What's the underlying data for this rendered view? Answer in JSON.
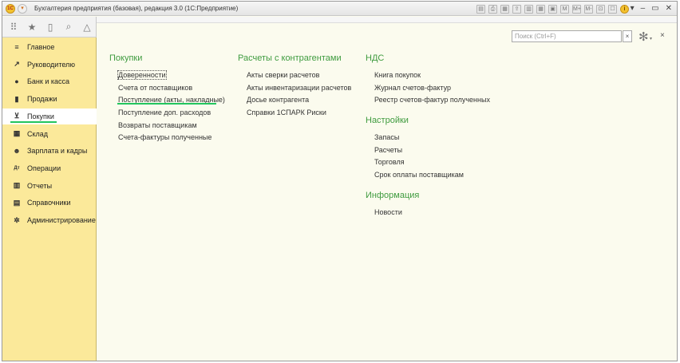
{
  "titlebar": {
    "logo": "1С",
    "title": "Бухгалтерия предприятия (базовая), редакция 3.0  (1С:Предприятие)",
    "tools": [
      "save-icon",
      "print-icon",
      "print-preview-icon",
      "upload-icon",
      "calendar-icon",
      "table-icon",
      "calculator-icon"
    ],
    "tool_glyphs": [
      "▤",
      "⎙",
      "▦",
      "⇪",
      "▥",
      "▦",
      "▣"
    ],
    "memory_labels": [
      "M",
      "M+",
      "M-"
    ],
    "zoom_glyph": "⊡",
    "history_glyph": "☐",
    "help_glyph": "i",
    "window_controls": [
      "▾",
      "–",
      "▭",
      "✕"
    ]
  },
  "toolstrip": {
    "icons": [
      {
        "name": "apps-grid-icon",
        "glyph": "⠿"
      },
      {
        "name": "favorites-star-icon",
        "glyph": "★"
      },
      {
        "name": "history-icon",
        "glyph": "▯"
      },
      {
        "name": "search-icon",
        "glyph": "⌕"
      },
      {
        "name": "notifications-bell-icon",
        "glyph": "△"
      }
    ]
  },
  "sidebar": {
    "items": [
      {
        "label": "Главное",
        "glyph": "≡",
        "name": "sidebar-item-main",
        "icon": "menu-lines-icon"
      },
      {
        "label": "Руководителю",
        "glyph": "↗",
        "name": "sidebar-item-manager",
        "icon": "trend-icon"
      },
      {
        "label": "Банк и касса",
        "glyph": "●",
        "name": "sidebar-item-bank",
        "icon": "coin-icon"
      },
      {
        "label": "Продажи",
        "glyph": "▮",
        "name": "sidebar-item-sales",
        "icon": "bag-icon"
      },
      {
        "label": "Покупки",
        "glyph": "⊻",
        "name": "sidebar-item-purchases",
        "icon": "cart-icon",
        "active": true
      },
      {
        "label": "Склад",
        "glyph": "▦",
        "name": "sidebar-item-warehouse",
        "icon": "warehouse-icon"
      },
      {
        "label": "Зарплата и кадры",
        "glyph": "☻",
        "name": "sidebar-item-salary",
        "icon": "person-icon"
      },
      {
        "label": "Операции",
        "glyph": "Дт",
        "name": "sidebar-item-operations",
        "icon": "debit-credit-icon"
      },
      {
        "label": "Отчеты",
        "glyph": "▥",
        "name": "sidebar-item-reports",
        "icon": "bar-chart-icon"
      },
      {
        "label": "Справочники",
        "glyph": "▤",
        "name": "sidebar-item-directories",
        "icon": "book-icon"
      },
      {
        "label": "Администрирование",
        "glyph": "✲",
        "name": "sidebar-item-admin",
        "icon": "gear-icon"
      }
    ]
  },
  "search": {
    "placeholder": "Поиск (Ctrl+F)",
    "clear": "×"
  },
  "main": {
    "settings_glyph": "✻",
    "settings_caret": "▾",
    "close_glyph": "×",
    "columns": [
      {
        "sections": [
          {
            "title": "Покупки",
            "links": [
              "Доверенности",
              "Счета от поставщиков",
              "Поступление (акты, накладные)",
              "Поступление доп. расходов",
              "Возвраты поставщикам",
              "Счета-фактуры полученные"
            ]
          }
        ]
      },
      {
        "sections": [
          {
            "title": "Расчеты с контрагентами",
            "links": [
              "Акты сверки расчетов",
              "Акты инвентаризации расчетов",
              "Досье контрагента",
              "Справки 1СПАРК Риски"
            ]
          }
        ]
      },
      {
        "sections": [
          {
            "title": "НДС",
            "links": [
              "Книга покупок",
              "Журнал счетов-фактур",
              "Реестр счетов-фактур полученных"
            ]
          },
          {
            "title": "Настройки",
            "links": [
              "Запасы",
              "Расчеты",
              "Торговля",
              "Срок оплаты поставщикам"
            ]
          },
          {
            "title": "Информация",
            "links": [
              "Новости"
            ]
          }
        ]
      }
    ]
  }
}
